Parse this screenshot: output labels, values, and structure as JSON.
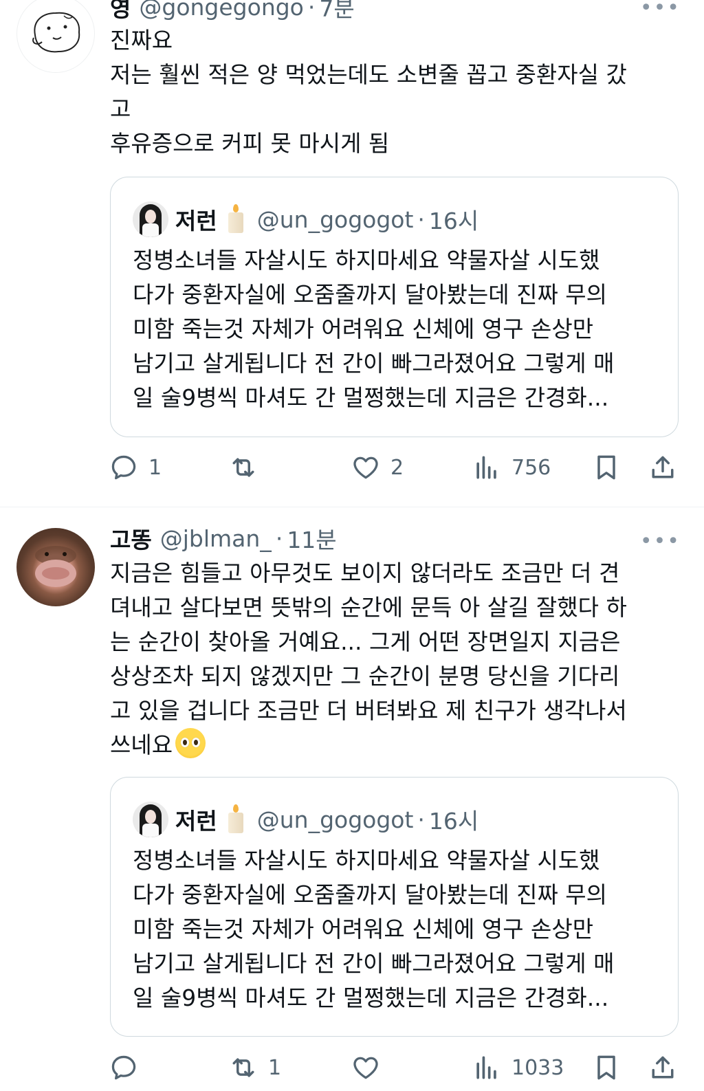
{
  "tweets": [
    {
      "name": "영",
      "handle": "@gongegongo",
      "dot": "·",
      "time": "7분",
      "more": "•••",
      "text": "진짜요\n저는 훨씬 적은 양 먹었는데도 소변줄 꼽고 중환자실 갔\n고\n후유증으로 커피 못 마시게 됨",
      "quote": {
        "name": "저런",
        "handle": "@un_gogogot",
        "dot": "·",
        "time": "16시",
        "text": "정병소녀들 자살시도 하지마세요 약물자살 시도했\n다가 중환자실에 오줌줄까지 달아봤는데 진짜 무의\n미함 죽는것 자체가 어려워요 신체에 영구 손상만\n남기고 살게됩니다 전 간이 빠그라졌어요 그렇게 매\n일 술9병씩 마셔도 간 멀쩡했는데 지금은 간경화..."
      },
      "replies": "1",
      "retweets": "",
      "likes": "2",
      "views": "756"
    },
    {
      "name": "고똥",
      "handle": "@jblman_",
      "dot": "·",
      "time": "11분",
      "more": "•••",
      "text": "지금은 힘들고 아무것도 보이지 않더라도 조금만 더 견\n뎌내고 살다보면 뜻밖의 순간에 문득 아 살길 잘했다 하\n는 순간이 찾아올 거예요... 그게 어떤 장면일지 지금은\n상상조차 되지 않겠지만 그 순간이 분명 당신을 기다리\n고 있을 겁니다 조금만 더 버텨봐요 제 친구가 생각나서\n쓰네요",
      "quote": {
        "name": "저런",
        "handle": "@un_gogogot",
        "dot": "·",
        "time": "16시",
        "text": "정병소녀들 자살시도 하지마세요 약물자살 시도했\n다가 중환자실에 오줌줄까지 달아봤는데 진짜 무의\n미함 죽는것 자체가 어려워요 신체에 영구 손상만\n남기고 살게됩니다 전 간이 빠그라졌어요 그렇게 매\n일 술9병씩 마셔도 간 멀쩡했는데 지금은 간경화..."
      },
      "replies": "",
      "retweets": "1",
      "likes": "",
      "views": "1033"
    }
  ],
  "icons": {
    "reply": "speech-bubble-icon",
    "retweet": "retweet-arrows-icon",
    "like": "heart-icon",
    "views": "bar-chart-icon",
    "bookmark": "bookmark-icon",
    "share": "share-upload-icon",
    "emoji": "pleading-face-emoji"
  },
  "colors": {
    "text": "#0f1419",
    "muted": "#536471",
    "border": "#cfd9de"
  }
}
